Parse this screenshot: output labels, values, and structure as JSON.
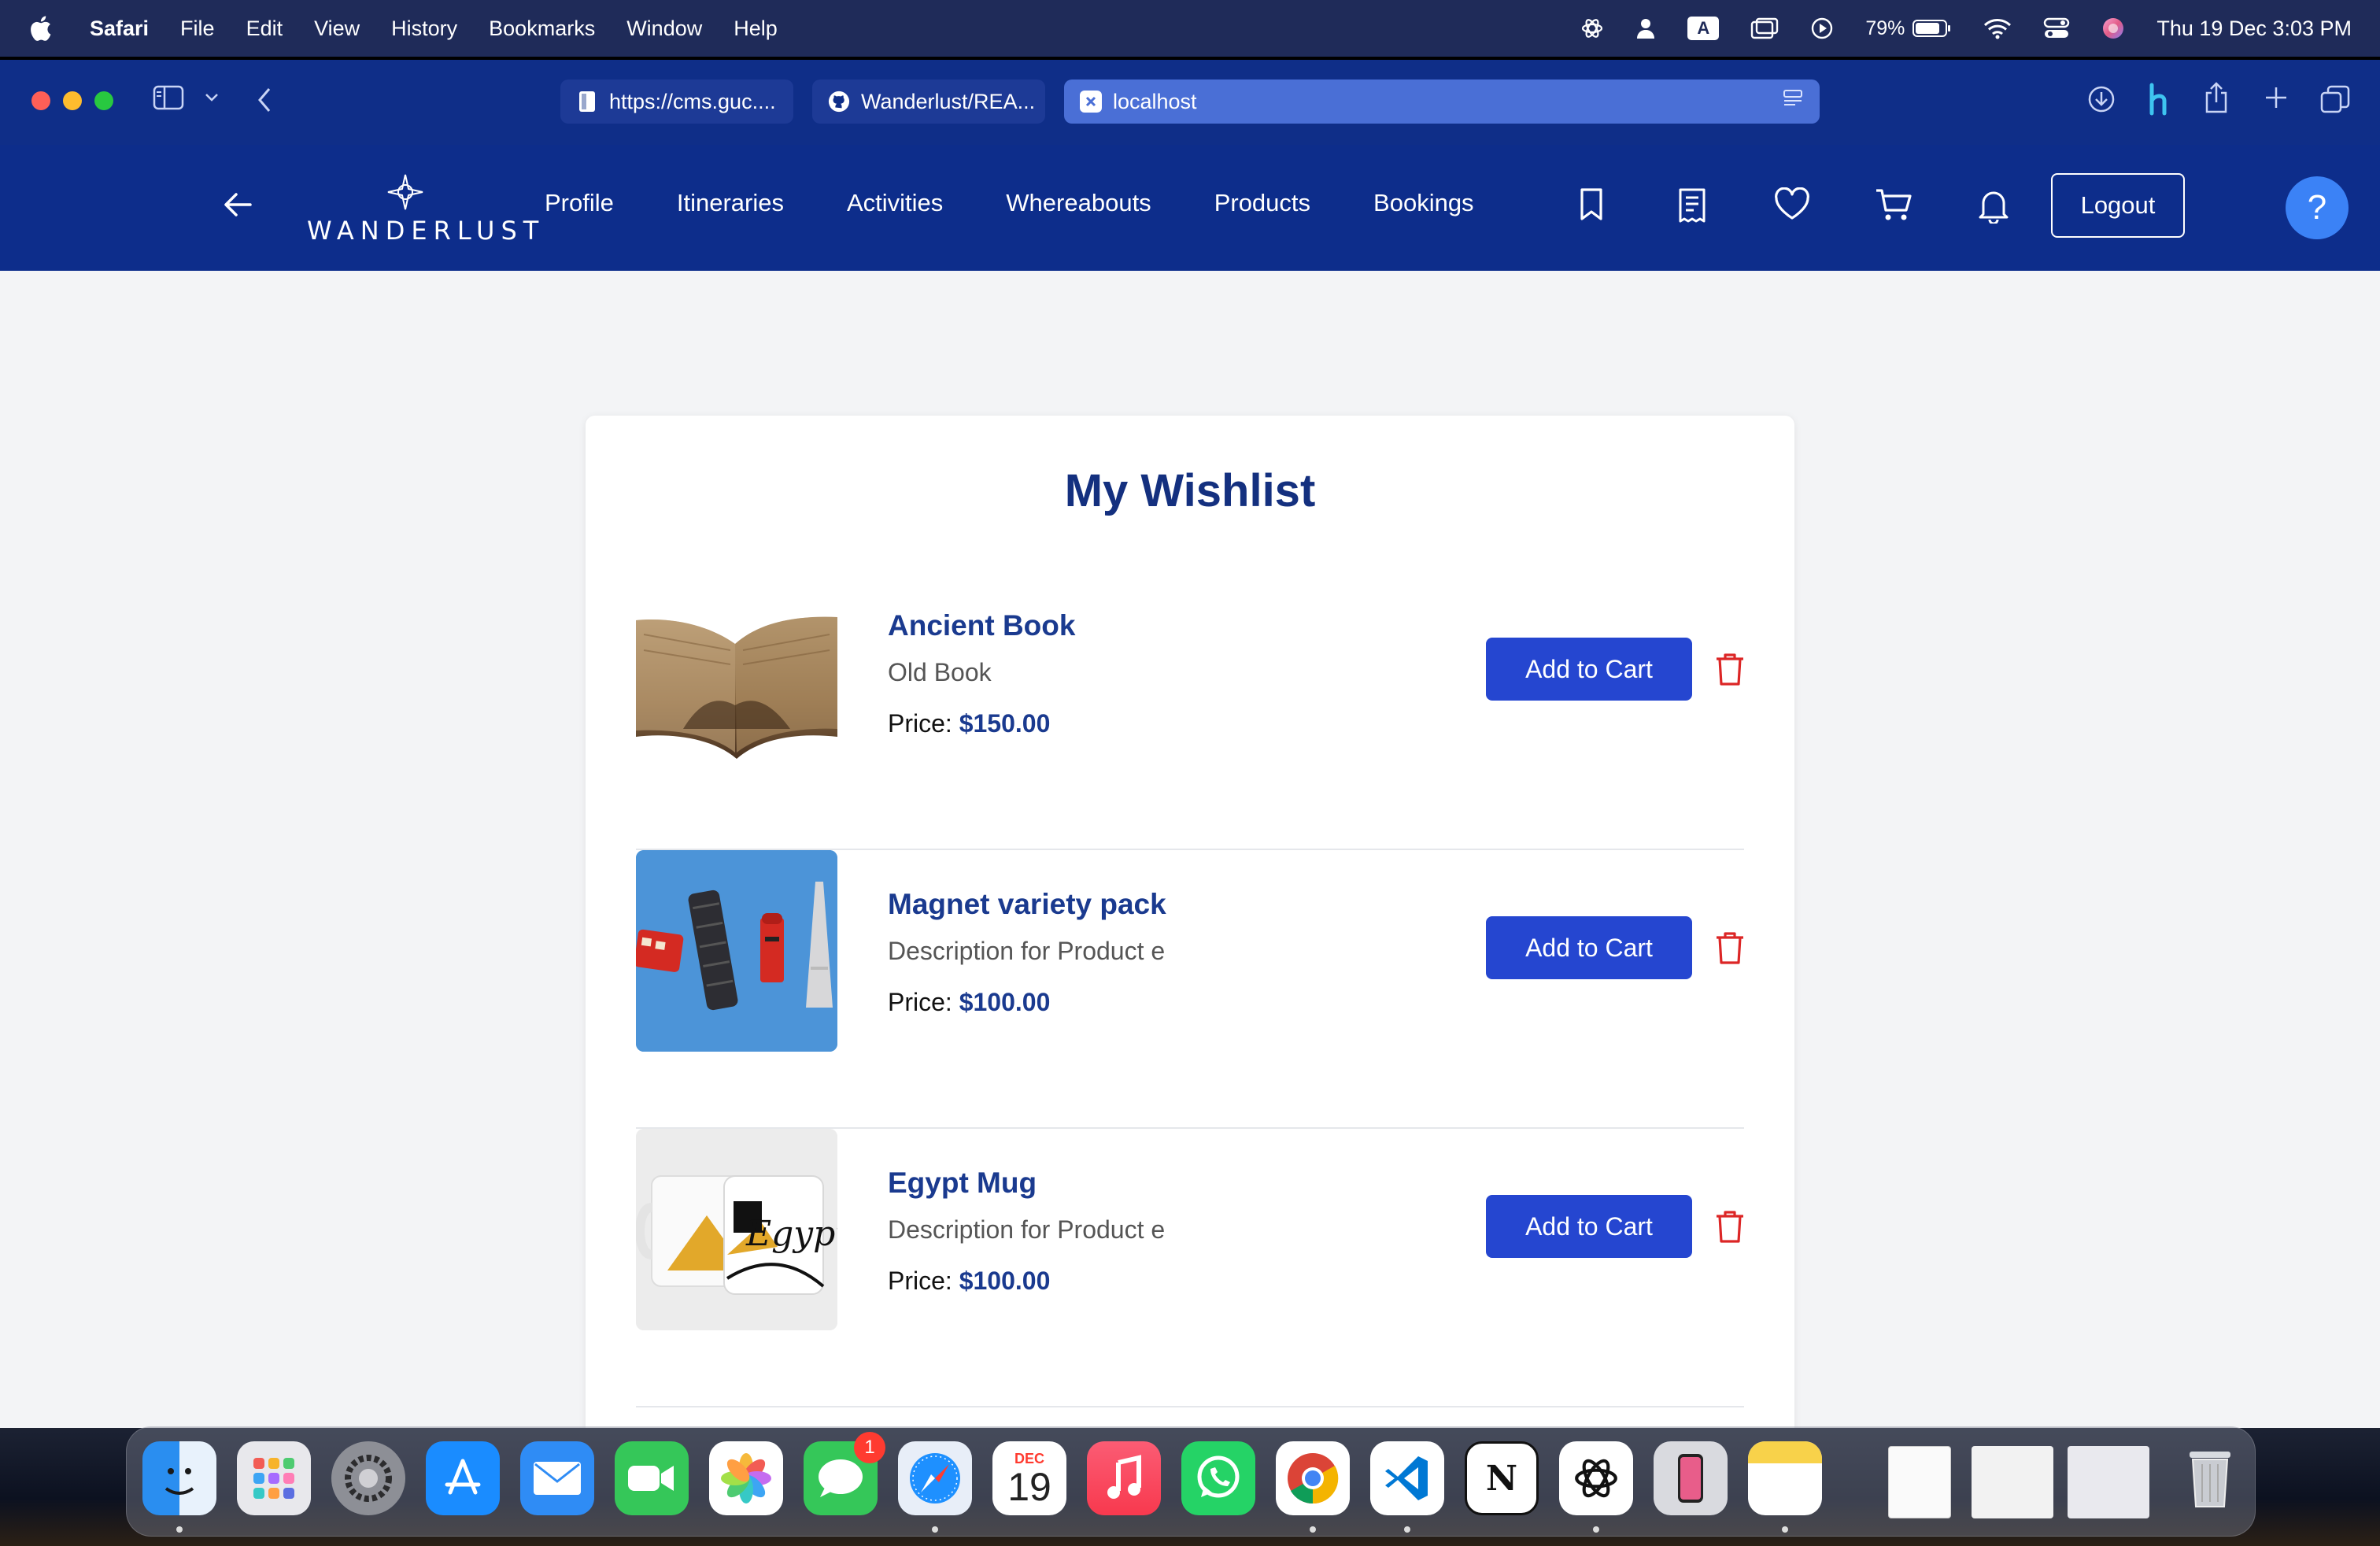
{
  "menubar": {
    "app_name": "Safari",
    "items": [
      "File",
      "Edit",
      "View",
      "History",
      "Bookmarks",
      "Window",
      "Help"
    ],
    "battery": "79%",
    "keyboard": "A",
    "clock": "Thu 19 Dec  3:03 PM"
  },
  "browser": {
    "tabs": [
      {
        "label": "https://cms.guc....",
        "icon": "document-icon"
      },
      {
        "label": "Wanderlust/REA...",
        "icon": "github-icon"
      },
      {
        "label": "localhost",
        "icon": "x-icon"
      }
    ]
  },
  "app": {
    "logo_text": "WANDERLUST",
    "nav": [
      "Profile",
      "Itineraries",
      "Activities",
      "Whereabouts",
      "Products",
      "Bookings"
    ],
    "icons": [
      "bookmark-icon",
      "receipt-icon",
      "heart-icon",
      "cart-icon",
      "bell-icon"
    ],
    "logout_label": "Logout",
    "help_label": "?"
  },
  "wishlist": {
    "title": "My Wishlist",
    "price_label": "Price:",
    "add_to_cart_label": "Add to Cart",
    "items": [
      {
        "name": "Ancient Book",
        "description": "Old Book",
        "price": "$150.00"
      },
      {
        "name": "Magnet variety pack",
        "description": "Description for Product e",
        "price": "$100.00"
      },
      {
        "name": "Egypt Mug",
        "description": "Description for Product e",
        "price": "$100.00"
      }
    ]
  },
  "colors": {
    "nav_bg": "#0d2d8b",
    "accent": "#2546d0",
    "title": "#14307f",
    "delete": "#dc2626",
    "page_bg": "#f3f4f6"
  },
  "dock": {
    "calendar_month": "DEC",
    "calendar_day": "19",
    "messages_badge": "1"
  }
}
